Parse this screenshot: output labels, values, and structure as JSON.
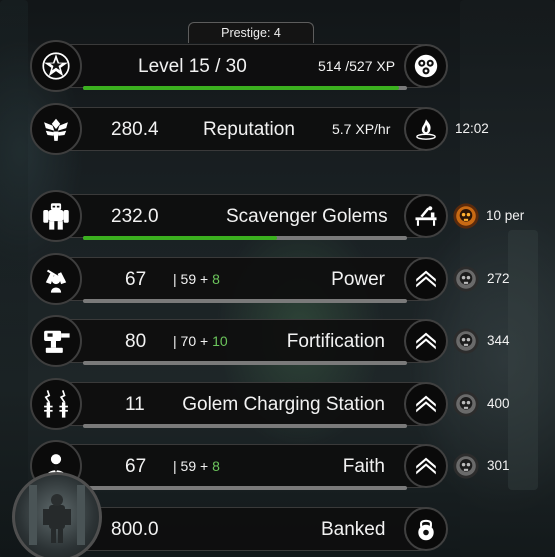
{
  "prestige": {
    "label": "Prestige: 4"
  },
  "level": {
    "label": "Level 15 / 30",
    "xp_text": "514 /527 XP",
    "progress": 0.975,
    "icon": "star-emblem-icon",
    "action_icon": "lab-flask-icon"
  },
  "reputation": {
    "value": "280.4",
    "label": "Reputation",
    "rate": "5.7 XP/hr",
    "timer": "12:02",
    "icon": "winged-emblem-icon",
    "action_icon": "fire-fountain-icon"
  },
  "golems": {
    "value": "232.0",
    "label": "Scavenger Golems",
    "cost": "10 per",
    "progress": 0.6,
    "icon": "golem-icon",
    "action_icon": "workbench-icon",
    "cost_icon": "fiery-skull-icon"
  },
  "upgrades": [
    {
      "id": "power",
      "value": "67",
      "base": "| 59",
      "plus": "+",
      "bonus": "8",
      "label": "Power",
      "cost": "272",
      "icon": "power-fist-icon",
      "has_breakdown": true
    },
    {
      "id": "fortification",
      "value": "80",
      "base": "| 70",
      "plus": "+",
      "bonus": "10",
      "label": "Fortification",
      "cost": "344",
      "icon": "turret-icon",
      "has_breakdown": true
    },
    {
      "id": "charging",
      "value": "11",
      "base": "",
      "plus": "",
      "bonus": "",
      "label": "Golem Charging Station",
      "cost": "400",
      "icon": "tesla-coil-icon",
      "has_breakdown": false
    },
    {
      "id": "faith",
      "value": "67",
      "base": "| 59",
      "plus": "+",
      "bonus": "8",
      "label": "Faith",
      "cost": "301",
      "icon": "praying-figure-icon",
      "has_breakdown": true
    }
  ],
  "banked": {
    "value": "800.0",
    "label": "Banked",
    "icon": "lock-icon"
  },
  "colors": {
    "progress_green": "#3bb01f",
    "bonus_green": "#6cc55c",
    "panel": "#0e0e0e"
  }
}
